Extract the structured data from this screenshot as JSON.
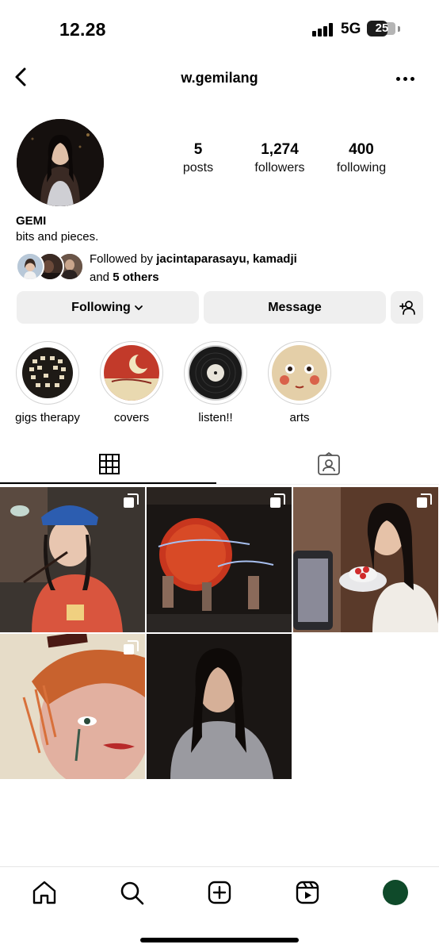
{
  "status_bar": {
    "time": "12.28",
    "network": "5G",
    "battery": "25"
  },
  "header": {
    "username": "w.gemilang",
    "back_icon": "chevron-left-icon",
    "more_icon": "more-horizontal-icon"
  },
  "profile": {
    "stats": [
      {
        "value": "5",
        "label": "posts"
      },
      {
        "value": "1,274",
        "label": "followers"
      },
      {
        "value": "400",
        "label": "following"
      }
    ],
    "display_name": "GEMI",
    "bio": "bits and pieces.",
    "followed_by_prefix": "Followed by ",
    "followed_by_names": "jacintaparasayu, kamadji",
    "followed_by_and": "and ",
    "followed_by_others": "5 others"
  },
  "actions": {
    "following": "Following",
    "message": "Message",
    "add_user_icon": "add-user-icon"
  },
  "highlights": [
    {
      "label": "gigs therapy"
    },
    {
      "label": "covers"
    },
    {
      "label": "listen!!"
    },
    {
      "label": "arts"
    }
  ],
  "tabs": [
    {
      "icon": "grid-icon",
      "active": true
    },
    {
      "icon": "tagged-icon",
      "active": false
    }
  ],
  "posts": [
    {
      "subject": "girl in cap with chopsticks",
      "multi": true
    },
    {
      "subject": "concert stage red moon",
      "multi": true
    },
    {
      "subject": "girl with cake",
      "multi": true
    },
    {
      "subject": "painted face artwork",
      "multi": true
    },
    {
      "subject": "portrait in grey top",
      "multi": false
    }
  ],
  "bottom_nav": [
    {
      "icon": "home-icon"
    },
    {
      "icon": "search-icon"
    },
    {
      "icon": "create-icon"
    },
    {
      "icon": "reels-icon"
    },
    {
      "icon": "profile-avatar-icon"
    }
  ],
  "colors": {
    "button_bg": "#efefef",
    "profile_nav_avatar": "#0f4a2a"
  }
}
